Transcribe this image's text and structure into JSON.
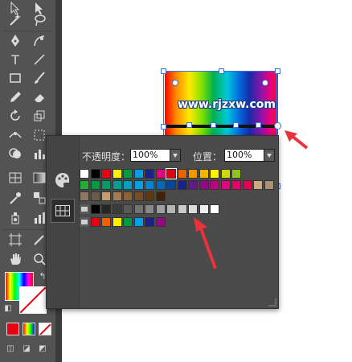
{
  "panel": {
    "opacity_label": "不透明度：",
    "opacity_value": "100%",
    "position_label": "位置：",
    "position_value": "100%"
  },
  "artwork": {
    "url_text": "www.rjzxw.com"
  },
  "colors": {
    "accent_arrow": "#e8333a",
    "selection": "#3c6fd9"
  },
  "swatches": {
    "row1": [
      "#ffffff",
      "#000000",
      "#e60012",
      "#fff100",
      "#009944",
      "#00a0e9",
      "#1d2088",
      "#e4007f",
      "#e60012",
      "#eb6100",
      "#f39800",
      "#f8b500",
      "#fff100",
      "#cfdb00",
      "#8fc31f"
    ],
    "row2": [
      "#22ac38",
      "#009944",
      "#009b6b",
      "#009e96",
      "#00a0c1",
      "#00a0e9",
      "#0086d1",
      "#0068b7",
      "#00479d",
      "#1d2088",
      "#601986",
      "#920783",
      "#be0081",
      "#e4007f",
      "#e5006a",
      "#e5004f",
      "#c9ab7f",
      "#a99273"
    ],
    "row3": [
      "#8c7863",
      "#6a5a48",
      "#c69c6d",
      "#a57c52",
      "#8c6239",
      "#754c24",
      "#603913",
      "#42210b"
    ],
    "row4_gray": [
      "#000000",
      "#262626",
      "#3c3c3c",
      "#595959",
      "#727272",
      "#898989",
      "#9f9f9f",
      "#b5b5b5",
      "#c9c9c9",
      "#dcdcdc",
      "#efefef",
      "#ffffff"
    ],
    "row5": [
      "#e60012",
      "#eb6100",
      "#fff100",
      "#009944",
      "#00a0e9",
      "#1d2088",
      "#920783"
    ]
  }
}
